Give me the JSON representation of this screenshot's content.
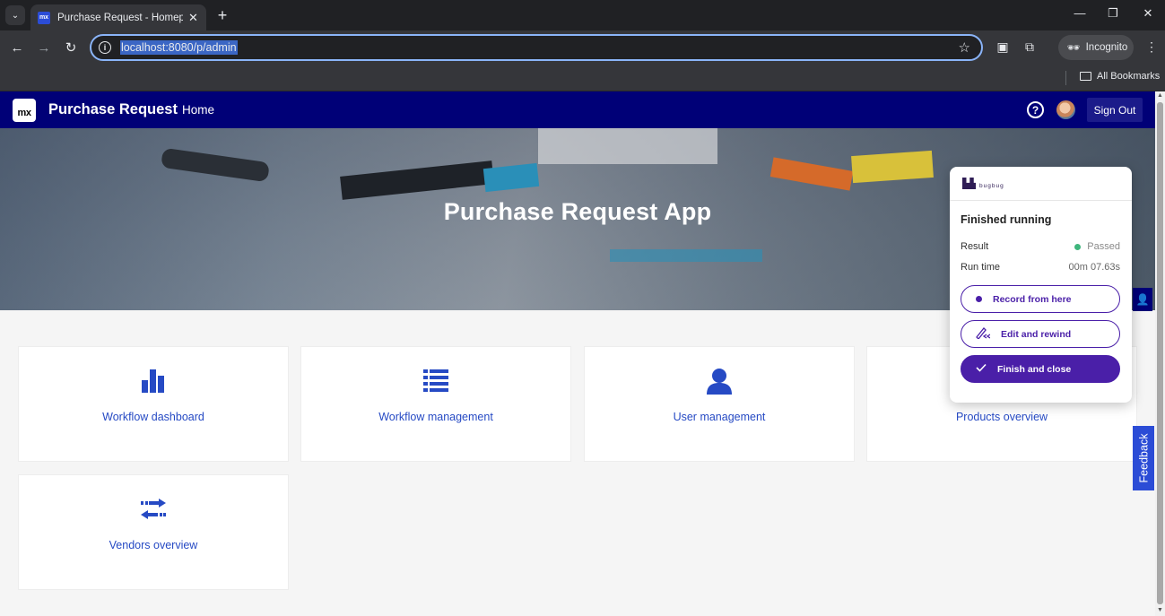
{
  "browser": {
    "tab_title": "Purchase Request - Homepage",
    "tab_favicon": "mx",
    "url": "localhost:8080/p/admin",
    "incognito_label": "Incognito",
    "bookmarks_label": "All Bookmarks"
  },
  "app": {
    "logo": "mx",
    "name": "Purchase Request",
    "nav_home": "Home",
    "sign_out": "Sign Out",
    "hero_title": "Purchase Request App",
    "brand_color": "#000077",
    "link_color": "#264ac4"
  },
  "cards": [
    {
      "label": "Workflow dashboard",
      "icon": "bar-chart-icon"
    },
    {
      "label": "Workflow management",
      "icon": "list-icon"
    },
    {
      "label": "User management",
      "icon": "user-icon"
    },
    {
      "label": "Products overview",
      "icon": "box-icon"
    },
    {
      "label": "Vendors overview",
      "icon": "exchange-icon"
    }
  ],
  "bugbug": {
    "logo_text": "bugbug",
    "status": "Finished running",
    "result_label": "Result",
    "result_value": "Passed",
    "runtime_label": "Run time",
    "runtime_value": "00m 07.63s",
    "btn_record": "Record from here",
    "btn_edit": "Edit and rewind",
    "btn_finish": "Finish and close",
    "accent": "#4a1fa8",
    "pass_color": "#3fb67d"
  },
  "feedback_label": "Feedback"
}
